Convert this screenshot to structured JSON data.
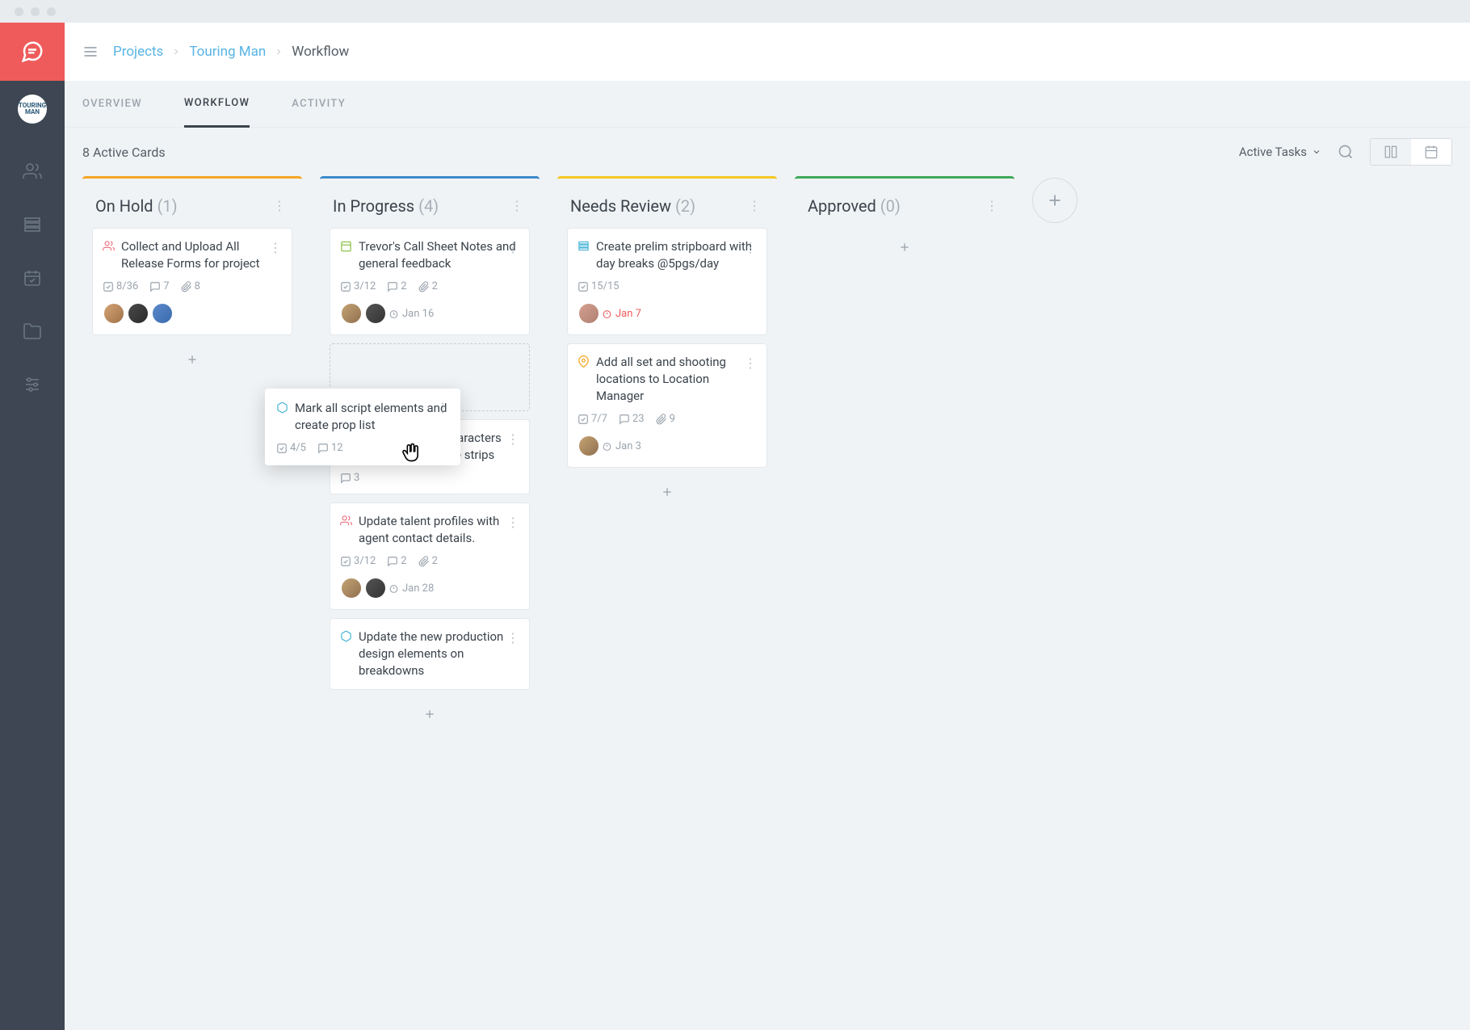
{
  "breadcrumb": {
    "root": "Projects",
    "project": "Touring Man",
    "page": "Workflow"
  },
  "tabs": {
    "overview": "OVERVIEW",
    "workflow": "WORKFLOW",
    "activity": "ACTIVITY"
  },
  "toolbar": {
    "active_cards": "8 Active Cards",
    "filter": "Active Tasks"
  },
  "rail": {
    "logo_text": "TOURING MAN"
  },
  "drag": {
    "title": "Mark all script elements and create prop list",
    "checks": "4/5",
    "comments": "12"
  },
  "columns": {
    "on_hold": {
      "title": "On Hold",
      "count": "(1)",
      "c1": {
        "title": "Collect and Upload All Release Forms for project",
        "checks": "8/36",
        "comments": "7",
        "attach": "8"
      }
    },
    "in_progress": {
      "title": "In Progress",
      "count": "(4)",
      "c1": {
        "title": "Trevor's Call Sheet Notes and general feedback",
        "checks": "3/12",
        "comments": "2",
        "attach": "2",
        "due": "Jan 16"
      },
      "c2": {
        "title": "Add all missing characters and talent to scene strips",
        "comments": "3"
      },
      "c3": {
        "title": "Update talent profiles with agent contact details.",
        "checks": "3/12",
        "comments": "2",
        "attach": "2",
        "due": "Jan 28"
      },
      "c4": {
        "title": "Update the new production design elements on breakdowns"
      }
    },
    "needs_review": {
      "title": "Needs Review",
      "count": "(2)",
      "c1": {
        "title": "Create prelim stripboard with day breaks @5pgs/day",
        "checks": "15/15",
        "due": "Jan 7"
      },
      "c2": {
        "title": "Add all set and shooting locations to Location Manager",
        "checks": "7/7",
        "comments": "23",
        "attach": "9",
        "due": "Jan 3"
      }
    },
    "approved": {
      "title": "Approved",
      "count": "(0)"
    }
  }
}
